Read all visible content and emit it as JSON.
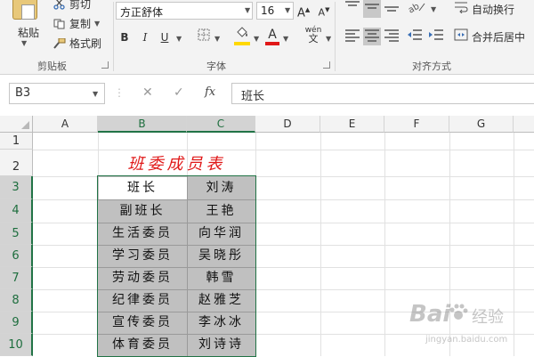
{
  "ribbon": {
    "clipboard": {
      "paste_label": "粘贴",
      "cut_label": "剪切",
      "copy_label": "复制",
      "format_painter_label": "格式刷",
      "group_label": "剪贴板"
    },
    "font": {
      "font_name": "方正舒体",
      "font_size": "16",
      "grow_label": "A",
      "shrink_label": "A",
      "bold_label": "B",
      "italic_label": "I",
      "underline_label": "U",
      "phonetic_label": "wén",
      "phonetic_sub": "文",
      "font_color_label": "A",
      "group_label": "字体",
      "fill_color": "#ffd800",
      "font_color": "#e01818"
    },
    "alignment": {
      "wrap_label": "自动换行",
      "merge_label": "合并后居中",
      "group_label": "对齐方式"
    }
  },
  "formula_bar": {
    "name_box": "B3",
    "cancel_icon": "✕",
    "enter_icon": "✓",
    "fx_label": "fx",
    "value": "班长"
  },
  "grid": {
    "columns": [
      "A",
      "B",
      "C",
      "D",
      "E",
      "F",
      "G"
    ],
    "rows": [
      "1",
      "2",
      "3",
      "4",
      "5",
      "6",
      "7",
      "8",
      "9",
      "10"
    ],
    "title": "班委成员表",
    "roles": [
      "班长",
      "副班长",
      "生活委员",
      "学习委员",
      "劳动委员",
      "纪律委员",
      "宣传委员",
      "体育委员"
    ],
    "names": [
      "刘涛",
      "王艳",
      "向华润",
      "吴晓彤",
      "韩雪",
      "赵雅芝",
      "李冰冰",
      "刘诗诗"
    ],
    "accent_color": "#217346"
  },
  "watermark": {
    "brand": "Bai",
    "brand_suffix": "经验",
    "site": "jingyan.baidu.com"
  }
}
